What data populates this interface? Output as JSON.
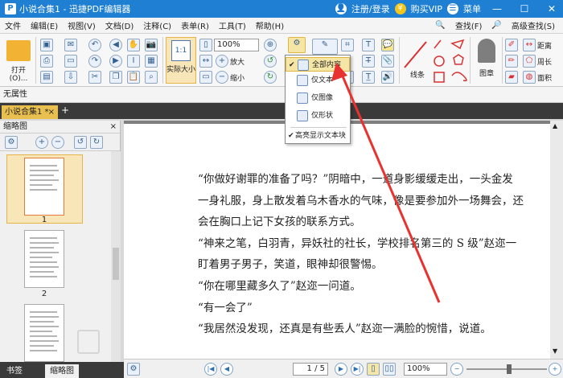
{
  "window": {
    "title": "小说合集1 - 迅捷PDF编辑器",
    "logo_glyph": "P",
    "login": "注册/登录",
    "vip": "购买VIP",
    "menu": "菜单"
  },
  "menubar": {
    "items": [
      "文件",
      "编辑(E)",
      "视图(V)",
      "文档(D)",
      "注释(C)",
      "表单(R)",
      "工具(T)",
      "帮助(H)"
    ],
    "find": "查找(F)",
    "advanced_find": "高级查找(S)"
  },
  "ribbon": {
    "open": "打开(O)...",
    "actual_size": "实际大小",
    "zoom_value": "100%",
    "zoom_in": "放大",
    "zoom_out": "缩小",
    "lines": "线条",
    "stamp": "图章",
    "distance": "距离",
    "perimeter": "周长",
    "area": "面积",
    "actual_size_glyph": "1:1"
  },
  "status_line": "无属性",
  "tabs": {
    "doc_tab": "小说合集1 *",
    "close": "×",
    "add": "+"
  },
  "left_panel": {
    "title": "缩略图",
    "close": "×",
    "page_numbers": [
      "1",
      "2"
    ],
    "bottom_tabs": [
      "书签",
      "缩略图"
    ]
  },
  "dropdown": {
    "items": [
      {
        "label": "全部内容",
        "checked": true
      },
      {
        "label": "仅文本",
        "checked": false
      },
      {
        "label": "仅图像",
        "checked": false
      },
      {
        "label": "仅形状",
        "checked": false
      }
    ],
    "highlight": "高亮显示文本块",
    "check_glyph": "✔"
  },
  "document": {
    "paragraphs": [
      "“你做好谢罪的准备了吗？”阴暗中，一道身影缓缓走出，一头金发",
      "一身礼服，身上散发着乌木香水的气味，像是要参加外一场舞会，还",
      "会在胸口上记下女孩的联系方式。",
      "“神来之笔，白羽青，异妖社的社长，学校排名第三的 S 级”赵迩一",
      "盯着男子男子，笑道，眼神却很警惕。",
      "“你在哪里藏多久了”赵迩一问道。",
      "“有一会了”",
      "“我居然没发现，还真是有些丢人”赵迩一满脸的惋惜，说道。"
    ]
  },
  "navbar": {
    "page_value": "1 / 5",
    "zoom_value": "100%"
  },
  "colors": {
    "titlebar": "#1e7fd3",
    "tab_active": "#e9c04f",
    "arrow": "#e8322f",
    "selection": "#f5e6a6"
  }
}
